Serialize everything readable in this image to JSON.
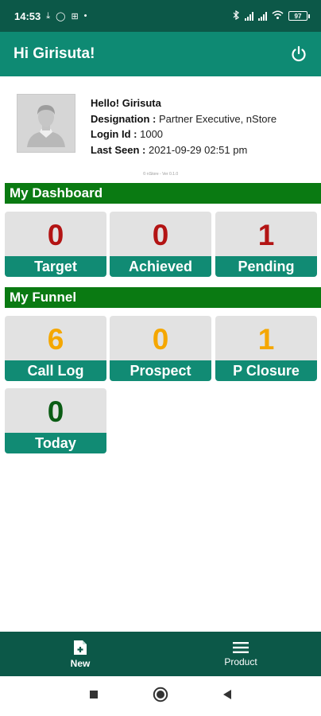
{
  "status_bar": {
    "time": "14:53",
    "battery": "97"
  },
  "app_bar": {
    "title": "Hi Girisuta!"
  },
  "profile": {
    "greeting": "Hello! Girisuta",
    "designation_label": "Designation :",
    "designation_value": "Partner Executive, nStore",
    "login_label": "Login Id :",
    "login_value": "1000",
    "last_seen_label": "Last Seen :",
    "last_seen_value": "2021-09-29 02:51 pm"
  },
  "version_text": "© nStore - Ver 0.1.0",
  "dashboard": {
    "title": "My Dashboard",
    "tiles": [
      {
        "value": "0",
        "label": "Target",
        "color": "#b31414"
      },
      {
        "value": "0",
        "label": "Achieved",
        "color": "#b31414"
      },
      {
        "value": "1",
        "label": "Pending",
        "color": "#b31414"
      }
    ]
  },
  "funnel": {
    "title": "My Funnel",
    "tiles": [
      {
        "value": "6",
        "label": "Call Log",
        "color": "#f5a700"
      },
      {
        "value": "0",
        "label": "Prospect",
        "color": "#f5a700"
      },
      {
        "value": "1",
        "label": "P Closure",
        "color": "#f5a700"
      },
      {
        "value": "0",
        "label": "Today",
        "color": "#0a5c14"
      }
    ]
  },
  "bottom_nav": {
    "items": [
      {
        "label": "New",
        "icon": "add-document-icon"
      },
      {
        "label": "Product",
        "icon": "menu-icon"
      }
    ]
  },
  "colors": {
    "status_bar": "#0c5848",
    "app_bar": "#0e8a73",
    "section_header": "#0a7a12",
    "tile_label": "#118b74"
  }
}
